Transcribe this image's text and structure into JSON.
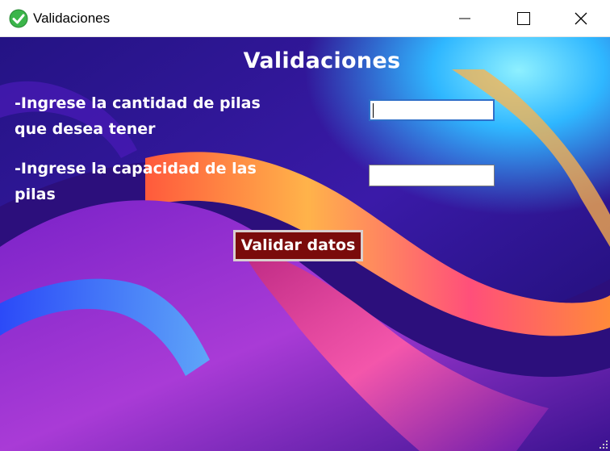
{
  "window": {
    "title": "Validaciones",
    "icon": "green-check-icon",
    "controls": [
      "minimize-icon",
      "maximize-icon",
      "close-icon"
    ]
  },
  "form": {
    "heading": "Validaciones",
    "pilas_cantidad_label": "-Ingrese la cantidad de pilas que desea tener",
    "pilas_cantidad_value": "",
    "pilas_capacidad_label": "-Ingrese la capacidad de las pilas",
    "pilas_capacidad_value": "",
    "validate_label": "Validar datos"
  },
  "colors": {
    "button_bg": "#7a0b0b",
    "focus_border": "#2f6fc9"
  }
}
